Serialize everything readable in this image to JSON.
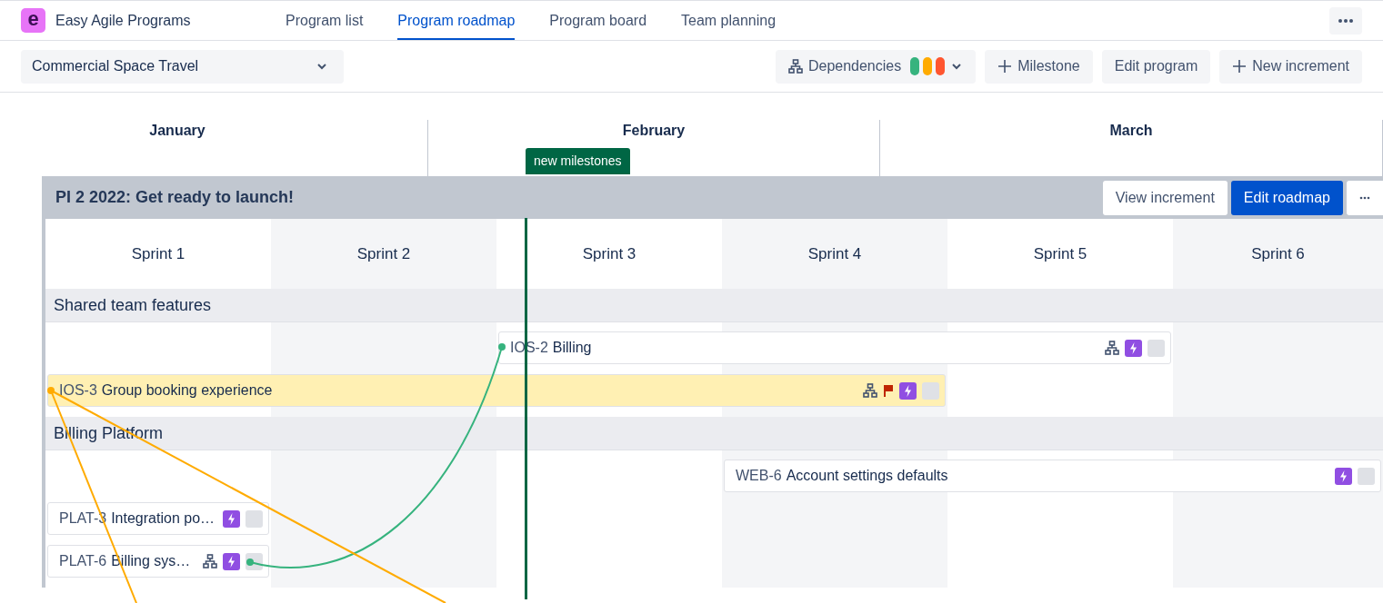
{
  "app": {
    "logo": "e",
    "name": "Easy Agile Programs"
  },
  "nav_tabs": [
    {
      "label": "Program list",
      "selected": false
    },
    {
      "label": "Program roadmap",
      "selected": true
    },
    {
      "label": "Program board",
      "selected": false
    },
    {
      "label": "Team planning",
      "selected": false
    }
  ],
  "program_select": {
    "value": "Commercial Space Travel"
  },
  "toolbar": [
    {
      "kind": "dependencies",
      "label": "Dependencies",
      "legend": [
        {
          "color": "#36b37e"
        },
        {
          "color": "#ffab00"
        },
        {
          "color": "#ff5630"
        }
      ]
    },
    {
      "kind": "add",
      "label": "Milestone"
    },
    {
      "kind": "plain",
      "label": "Edit program"
    },
    {
      "kind": "add",
      "label": "New increment"
    }
  ],
  "months": [
    "January",
    "February",
    "March"
  ],
  "milestone": {
    "label": "new milestones"
  },
  "increment": {
    "title": "PI 2 2022: Get ready to launch!",
    "buttons": [
      {
        "kind": "secondary",
        "label": "View increment"
      },
      {
        "kind": "primary",
        "label": "Edit roadmap"
      }
    ]
  },
  "sprints": [
    "Sprint 1",
    "Sprint 2",
    "Sprint 3",
    "Sprint 4",
    "Sprint 5",
    "Sprint 6"
  ],
  "teams": [
    {
      "name": "Shared team features",
      "features": [
        {
          "key": "IOS-2",
          "title": "Billing",
          "highlighted": false,
          "has_dependencies": true,
          "flagged": false
        },
        {
          "key": "IOS-3",
          "title": "Group booking experience",
          "highlighted": true,
          "has_dependencies": true,
          "flagged": true
        }
      ]
    },
    {
      "name": "Billing Platform",
      "features": [
        {
          "key": "WEB-6",
          "title": "Account settings defaults",
          "highlighted": false,
          "has_dependencies": false,
          "flagged": false
        },
        {
          "key": "PLAT-3",
          "title": "Integration po…",
          "highlighted": false,
          "has_dependencies": false,
          "flagged": false
        },
        {
          "key": "PLAT-6",
          "title": "Billing sys…",
          "highlighted": false,
          "has_dependencies": true,
          "flagged": false
        }
      ]
    }
  ]
}
